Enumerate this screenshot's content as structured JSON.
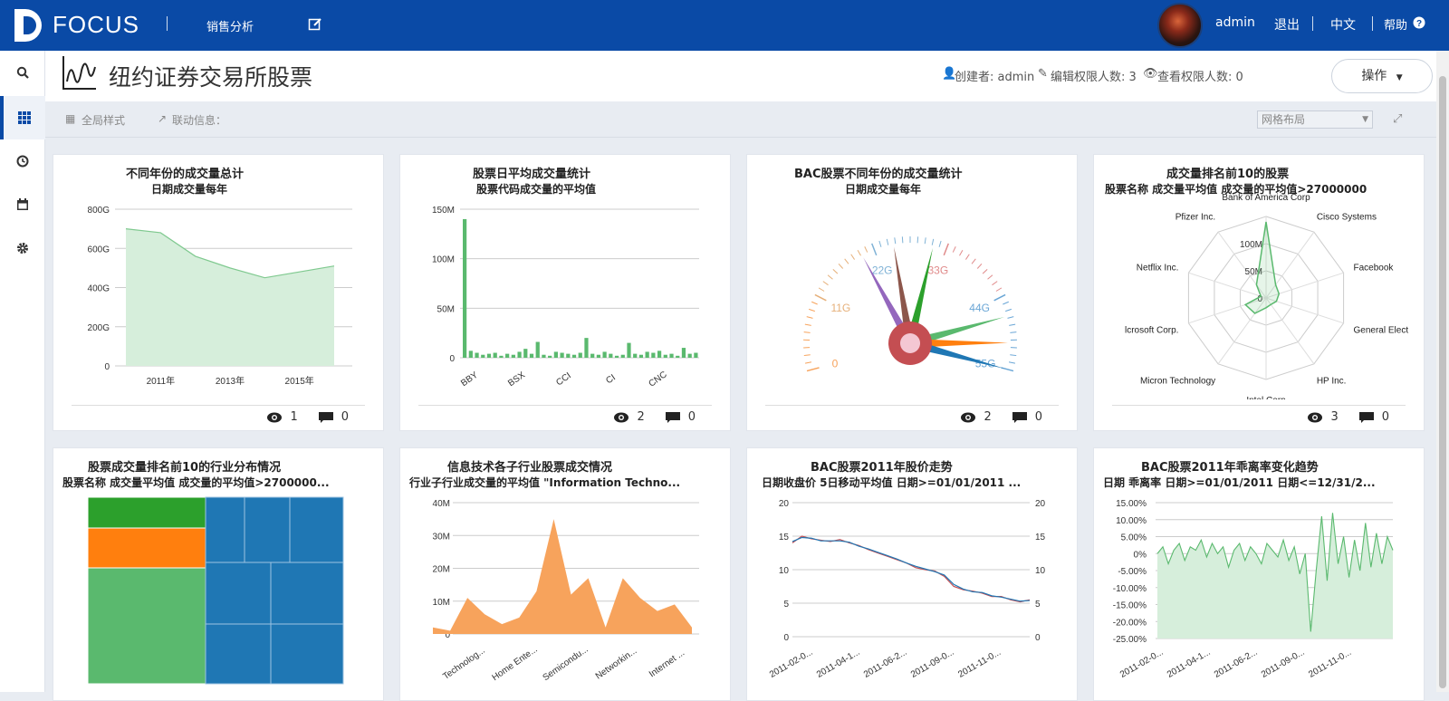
{
  "app": {
    "brand": "FOCUS",
    "nav_analysis": "销售分析"
  },
  "user": {
    "name": "admin",
    "logout": "退出",
    "lang": "中文",
    "help": "帮助"
  },
  "page": {
    "title": "纽约证券交易所股票",
    "creator": "创建者: admin",
    "edit_perm": "编辑权限人数: 3",
    "view_perm": "查看权限人数: 0",
    "op_button": "操作"
  },
  "toolbar": {
    "global_style": "全局样式",
    "linkage": "联动信息：",
    "layout": "网格布局"
  },
  "colors": {
    "topbar": "#0a4aa6",
    "area_green": "#7fc98f",
    "bar_green": "#5ab96e",
    "orange": "#f7a35c",
    "blue": "#1f77b4"
  },
  "cards": [
    {
      "title": "不同年份的成交量总计",
      "subtitle": "日期成交量每年",
      "views": "1",
      "comments": "0",
      "chart_data": {
        "type": "area",
        "x": [
          2010,
          2011,
          2012,
          2013,
          2014,
          2015,
          2016
        ],
        "values": [
          700,
          680,
          560,
          500,
          450,
          480,
          510
        ],
        "xticks": [
          "2011年",
          "2013年",
          "2015年"
        ],
        "yticks": [
          "0",
          "200G",
          "400G",
          "600G",
          "800G"
        ],
        "ylim": [
          0,
          800
        ]
      }
    },
    {
      "title": "股票日平均成交量统计",
      "subtitle": "股票代码成交量的平均值",
      "views": "2",
      "comments": "0",
      "chart_data": {
        "type": "bar",
        "categories": [
          "BBY",
          "BSX",
          "CCI",
          "CI",
          "CNC"
        ],
        "values": [
          140,
          7,
          5,
          3,
          4,
          5,
          2,
          4,
          3,
          6,
          9,
          4,
          16,
          3,
          2,
          6,
          5,
          4,
          3,
          5,
          20,
          4,
          3,
          6,
          4,
          2,
          3,
          15,
          4,
          3,
          6,
          5,
          7,
          3,
          4,
          2,
          10,
          4,
          5
        ],
        "yticks": [
          "0",
          "50M",
          "100M",
          "150M"
        ],
        "ylim": [
          0,
          150
        ]
      }
    },
    {
      "title": "BAC股票不同年份的成交量统计",
      "subtitle": "日期成交量每年",
      "views": "2",
      "comments": "0",
      "chart_data": {
        "type": "gauge",
        "labels": [
          "0",
          "11G",
          "22G",
          "33G",
          "44G",
          "55G"
        ],
        "max": 55,
        "needles": [
          {
            "value": 20,
            "color": "#9467bd"
          },
          {
            "value": 25,
            "color": "#8c564b"
          },
          {
            "value": 31,
            "color": "#2ca02c"
          },
          {
            "value": 47,
            "color": "#5ab96e"
          },
          {
            "value": 51,
            "color": "#ff7f0e"
          },
          {
            "value": 55,
            "color": "#1f77b4"
          }
        ]
      }
    },
    {
      "title": "成交量排名前10的股票",
      "subtitle": "股票名称 成交量平均值 成交量的平均值>27000000",
      "views": "3",
      "comments": "0",
      "chart_data": {
        "type": "radar",
        "axes": [
          "Bank of America Corp",
          "Cisco Systems",
          "Facebook",
          "General Elect",
          "HP Inc.",
          "Intel Corp",
          "Micron Technology",
          "Microsoft Corp.",
          "Netflix Inc.",
          "Pfizer Inc."
        ],
        "axis_labels_shown": [
          "Bank of America Corp",
          "Cisco Systems",
          "Facebook",
          "General Elect",
          "HP Inc.",
          "Intel Corp",
          "Micron Technology",
          "lcrosoft Corp.",
          "Netflix Inc.",
          "Pfizer Inc."
        ],
        "values": [
          140,
          30,
          25,
          20,
          15,
          18,
          35,
          40,
          10,
          30
        ],
        "rticks": [
          "0",
          "50M",
          "100M"
        ],
        "rmax": 150
      }
    },
    {
      "title": "股票成交量排名前10的行业分布情况",
      "subtitle": "股票名称 成交量平均值 成交量的平均值>2700000...",
      "views": "",
      "comments": "",
      "chart_data": {
        "type": "treemap",
        "groups": [
          {
            "color": "#2ca02c",
            "value": 1
          },
          {
            "color": "#ff7f0e",
            "value": 1
          },
          {
            "color": "#5ab96e",
            "value": 3
          },
          {
            "color": "#1f77b4",
            "value": 6
          }
        ]
      }
    },
    {
      "title": "信息技术各子行业股票成交情况",
      "subtitle": "行业子行业成交量的平均值 \"Information Techno...",
      "views": "",
      "comments": "",
      "chart_data": {
        "type": "area",
        "values": [
          2,
          1,
          11,
          6,
          3,
          5,
          13,
          35,
          12,
          17,
          2,
          17,
          11,
          7,
          9,
          2
        ],
        "xticks": [
          "Technolog...",
          "Home Ente...",
          "Semicondu...",
          "Networkin...",
          "Internet ..."
        ],
        "yticks": [
          "0",
          "10M",
          "20M",
          "30M",
          "40M"
        ],
        "ylim": [
          0,
          40
        ]
      }
    },
    {
      "title": "BAC股票2011年股价走势",
      "subtitle": "日期收盘价 5日移动平均值 日期>=01/01/2011 ...",
      "views": "",
      "comments": "",
      "chart_data": {
        "type": "line",
        "series": [
          {
            "values": [
              14,
              15,
              14.6,
              14.4,
              14.2,
              14.5,
              14,
              13.6,
              13,
              12.5,
              12,
              11.5,
              11,
              10.3,
              10,
              9.8,
              9,
              7.5,
              7,
              6.8,
              6.5,
              6,
              6,
              5.5,
              5.2,
              5.5
            ]
          },
          {
            "values": [
              14.2,
              14.8,
              14.7,
              14.3,
              14.3,
              14.3,
              14.1,
              13.5,
              13.1,
              12.6,
              12.1,
              11.6,
              11,
              10.5,
              10.1,
              9.7,
              9.2,
              7.8,
              7.1,
              6.7,
              6.6,
              6.1,
              5.9,
              5.6,
              5.3,
              5.4
            ]
          }
        ],
        "xticks": [
          "2011-02-0...",
          "2011-04-1...",
          "2011-06-2...",
          "2011-09-0...",
          "2011-11-0..."
        ],
        "yticks": [
          "0",
          "5",
          "10",
          "15",
          "20"
        ],
        "ylim": [
          0,
          20
        ]
      }
    },
    {
      "title": "BAC股票2011年乖离率变化趋势",
      "subtitle": "日期 乖离率 日期>=01/01/2011 日期<=12/31/2...",
      "views": "",
      "comments": "",
      "chart_data": {
        "type": "area",
        "values": [
          0,
          2,
          -3,
          1,
          3,
          -2,
          2,
          1,
          4,
          -1,
          3,
          0,
          2,
          -4,
          1,
          3,
          -2,
          2,
          0,
          -3,
          3,
          1,
          -1,
          4,
          -2,
          2,
          -6,
          0,
          -23,
          -5,
          11,
          -8,
          12,
          -3,
          5,
          -7,
          4,
          -5,
          9,
          -4,
          6,
          -3,
          5,
          1
        ],
        "xticks": [
          "2011-02-0...",
          "2011-04-1...",
          "2011-06-2...",
          "2011-09-0...",
          "2011-11-0..."
        ],
        "yticks": [
          "-25.00%",
          "-20.00%",
          "-15.00%",
          "-10.00%",
          "-5.00%",
          "0%",
          "5.00%",
          "10.00%",
          "15.00%"
        ],
        "ylim": [
          -25,
          15
        ]
      }
    }
  ]
}
